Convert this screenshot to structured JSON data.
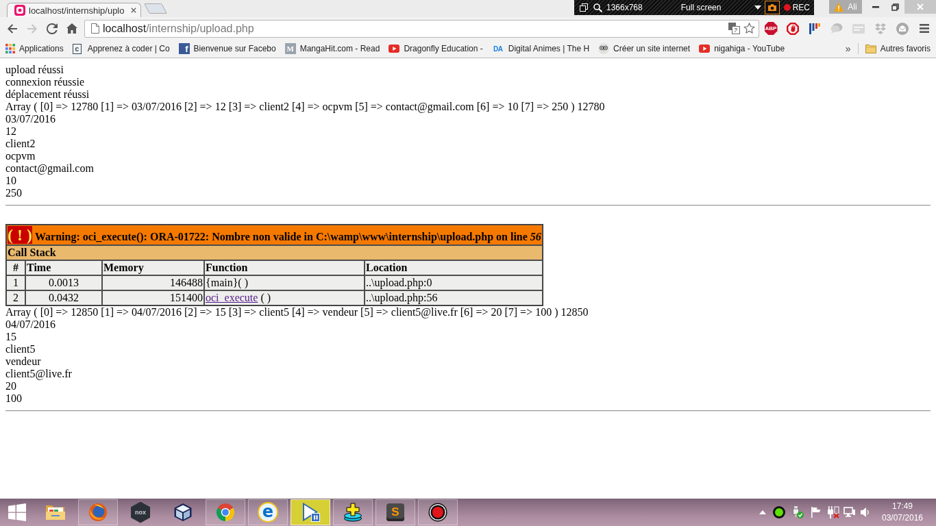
{
  "browser": {
    "tabs": [
      {
        "title": "localhost/internship/uplo",
        "selected": true
      }
    ],
    "recorder": {
      "size": "1366x768",
      "mode": "Full screen",
      "status": "REC"
    },
    "profile": {
      "name": "Ali",
      "warning": true
    },
    "nav_buttons": [
      {
        "kind": "back",
        "disabled": false
      },
      {
        "kind": "forward",
        "disabled": true
      },
      {
        "kind": "reload",
        "disabled": false
      },
      {
        "kind": "home",
        "disabled": false
      }
    ],
    "address": {
      "host": "localhost",
      "path": "/internship/upload.php"
    },
    "extensions": [
      {
        "kind": "abp",
        "label": "ABP"
      },
      {
        "kind": "stop"
      },
      {
        "kind": "bars"
      },
      {
        "kind": "bubble"
      },
      {
        "kind": "card"
      },
      {
        "kind": "boxes"
      },
      {
        "kind": "mail"
      }
    ],
    "bookmarks": [
      {
        "kind": "grid",
        "label": "Applications"
      },
      {
        "kind": "code",
        "glyph": "c",
        "label": "Apprenez à coder | Co"
      },
      {
        "kind": "facebook",
        "glyph": "f",
        "label": "Bienvenue sur Facebo"
      },
      {
        "kind": "tile",
        "glyph": "M",
        "label": "MangaHit.com - Read"
      },
      {
        "kind": "video",
        "label": "Dragonfly Education -"
      },
      {
        "kind": "letters",
        "glyph": "DA",
        "label": "Digital Animes | The H"
      },
      {
        "kind": "owl",
        "label": "Créer un site internet"
      },
      {
        "kind": "video",
        "label": "nigahiga - YouTube"
      }
    ],
    "bookmarks_more": "»",
    "other_bookmarks": "Autres favoris"
  },
  "page": {
    "blocks": [
      {
        "kind": "lines",
        "lines": [
          "upload réussi",
          "connexion réussie",
          "déplacement réussi",
          "Array ( [0] => 12780 [1] => 03/07/2016 [2] => 12 [3] => client2 [4] => ocpvm [5] => contact@gmail.com [6] => 10 [7] => 250 ) 12780",
          "03/07/2016",
          "12",
          "client2",
          "ocpvm",
          "contact@gmail.com",
          "10",
          "250"
        ]
      },
      {
        "kind": "rule"
      },
      {
        "kind": "error",
        "symbol": "( ! )",
        "message": "Warning: oci_execute(): ORA-01722: Nombre non valide in C:\\wamp\\www\\internship\\upload.php on line *56*",
        "stack_title": "Call Stack",
        "columns": [
          "#",
          "Time",
          "Memory",
          "Function",
          "Location"
        ],
        "rows": [
          {
            "number": "1",
            "time": "0.0013",
            "memory": "146488",
            "function": [
              {
                "text": "{main}( )",
                "link": false
              }
            ],
            "location": "..\\upload.php:0"
          },
          {
            "number": "2",
            "time": "0.0432",
            "memory": "151400",
            "function": [
              {
                "text": "oci_execute",
                "link": true
              },
              {
                "text": "( )",
                "link": false
              }
            ],
            "location": "..\\upload.php:56"
          }
        ]
      },
      {
        "kind": "lines",
        "lines": [
          "Array ( [0] => 12850 [1] => 04/07/2016 [2] => 15 [3] => client5 [4] => vendeur [5] => client5@live.fr [6] => 20 [7] => 100 ) 12850",
          "04/07/2016",
          "15",
          "client5",
          "vendeur",
          "client5@live.fr",
          "20",
          "100"
        ]
      },
      {
        "kind": "rule"
      }
    ]
  },
  "taskbar": {
    "apps": [
      {
        "kind": "explorer",
        "running": false,
        "selected": false
      },
      {
        "kind": "firefox",
        "running": true,
        "selected": false
      },
      {
        "kind": "nox",
        "glyph": "nox",
        "running": false,
        "selected": false
      },
      {
        "kind": "cube",
        "running": false,
        "selected": false
      },
      {
        "kind": "chrome",
        "running": true,
        "selected": false
      },
      {
        "kind": "ie",
        "glyph": "e",
        "running": true,
        "selected": false
      },
      {
        "kind": "player",
        "running": true,
        "selected": true
      },
      {
        "kind": "stack",
        "running": true,
        "selected": false
      },
      {
        "kind": "sublime",
        "glyph": "S",
        "running": true,
        "selected": false
      },
      {
        "kind": "record",
        "running": true,
        "selected": false
      }
    ],
    "clock": {
      "time": "17:49",
      "date": "03/07/2016"
    }
  }
}
